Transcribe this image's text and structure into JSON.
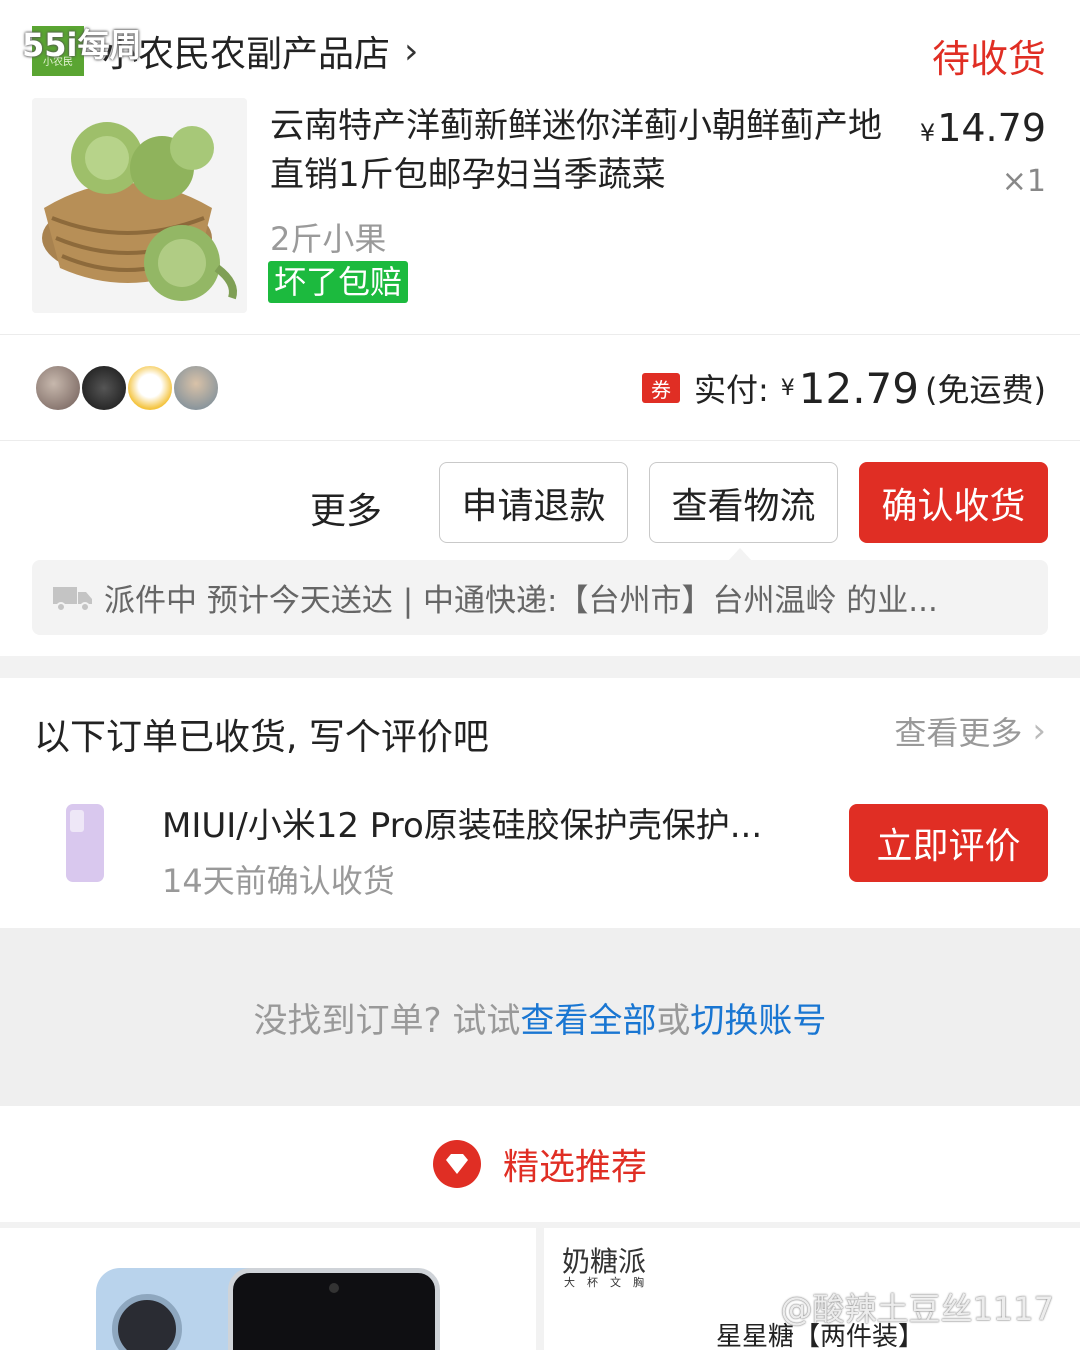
{
  "overlay_label": "55i每周",
  "order": {
    "shop_logo_text": "小农民",
    "shop_name": "小农民农副产品店",
    "status": "待收货",
    "product": {
      "title": "云南特产洋蓟新鲜迷你洋蓟小朝鲜蓟产地直销1斤包邮孕妇当季蔬菜",
      "price_symbol": "¥",
      "price": "14.79",
      "quantity": "×1",
      "spec": "2斤小果",
      "guarantee_badge": "坏了包赔"
    },
    "payment": {
      "coupon_icon_label": "券",
      "label": "实付:",
      "symbol": "¥",
      "amount": "12.79",
      "note": "(免运费)"
    },
    "actions": {
      "more": "更多",
      "refund": "申请退款",
      "logistics": "查看物流",
      "confirm": "确认收货"
    },
    "logistics_text": "派件中 预计今天送达 | 中通快递:【台州市】台州温岭 的业..."
  },
  "review_section": {
    "heading": "以下订单已收货, 写个评价吧",
    "see_more": "查看更多",
    "item_title": "MIUI/小米12 Pro原装硅胶保护壳保护...",
    "item_subtitle": "14天前确认收货",
    "review_button": "立即评价"
  },
  "not_found": {
    "prefix": "没找到订单? 试试",
    "link_all": "查看全部",
    "middle": "或",
    "link_switch": "切换账号"
  },
  "recommend": {
    "title": "精选推荐",
    "right_brand": "奶糖派",
    "right_brand_sub": "大杯文胸",
    "right_product_title": "星星糖【两件装】"
  },
  "watermark": "@酸辣土豆丝1117",
  "colors": {
    "accent_red": "#e02e24",
    "guarantee_green": "#1cba3e",
    "link_blue": "#1976d2",
    "shop_logo_green": "#5aa532"
  },
  "icons": [
    "chevron-right-icon",
    "coupon-icon",
    "truck-icon",
    "heart-diamond-icon"
  ]
}
